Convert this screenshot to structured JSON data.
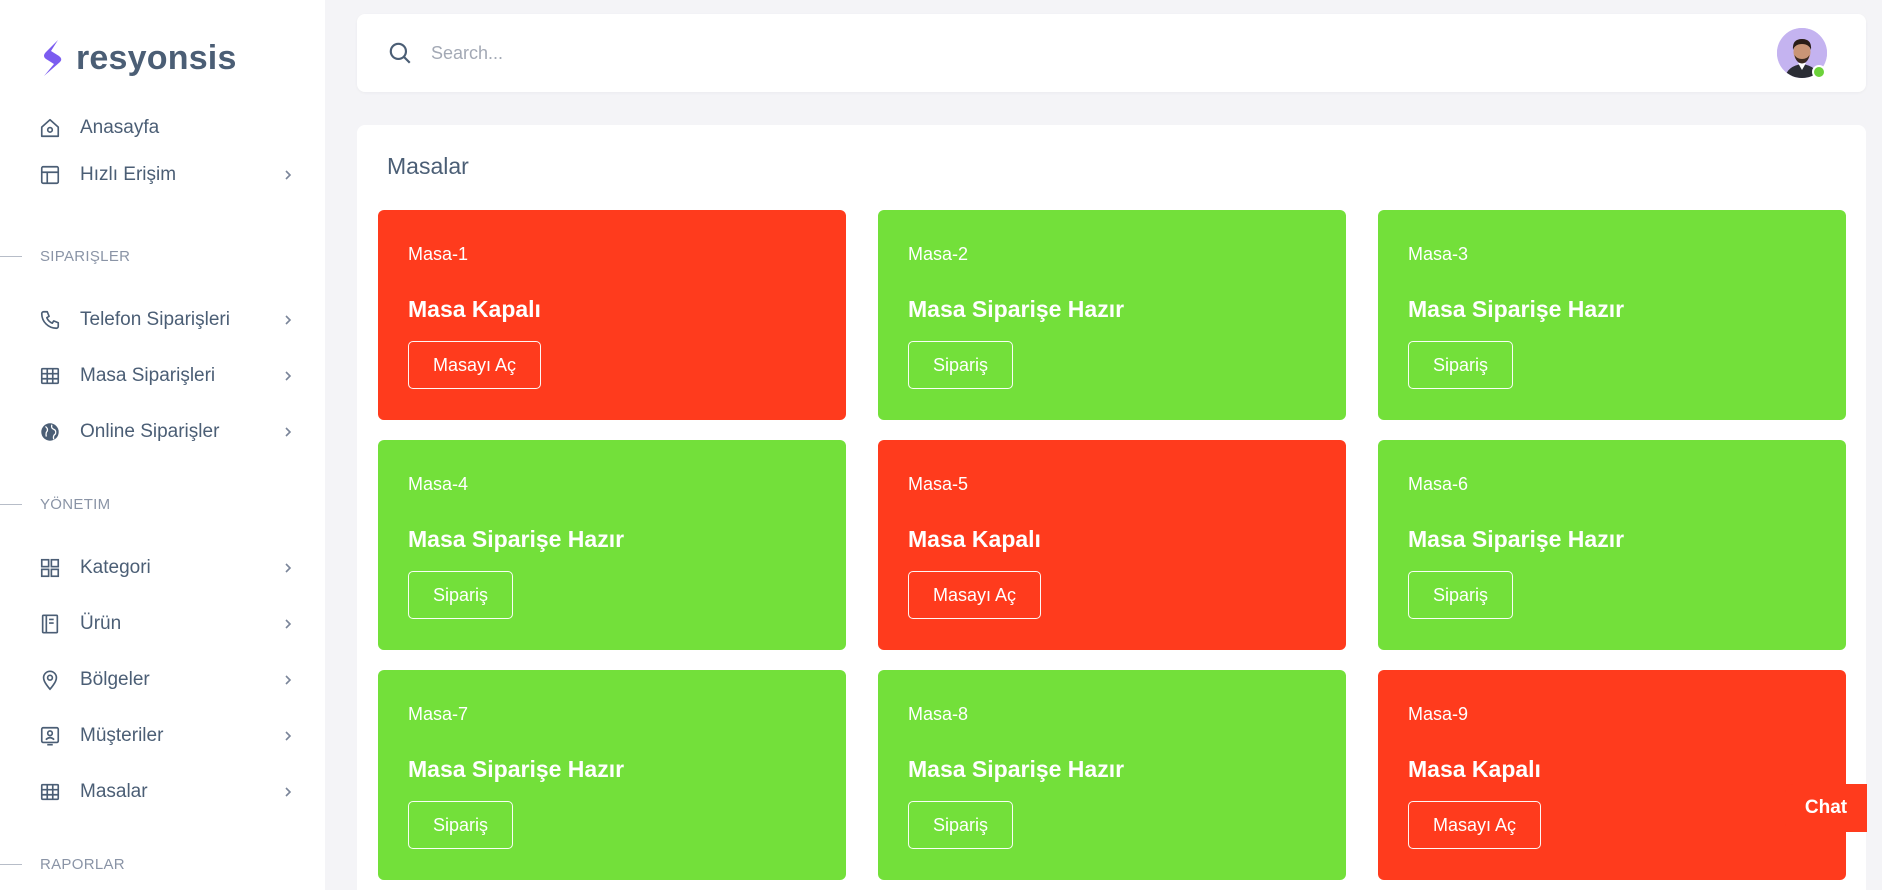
{
  "brand": {
    "name": "resyonsis"
  },
  "sidebar": {
    "items_top": [
      {
        "label": "Anasayfa",
        "icon": "home-icon",
        "chevron": false
      },
      {
        "label": "Hızlı Erişim",
        "icon": "layout-icon",
        "chevron": true
      }
    ],
    "section_orders": "SIPARIŞLER",
    "items_orders": [
      {
        "label": "Telefon Siparişleri",
        "icon": "phone-icon",
        "chevron": true
      },
      {
        "label": "Masa Siparişleri",
        "icon": "table-icon",
        "chevron": true
      },
      {
        "label": "Online Siparişler",
        "icon": "globe-icon",
        "chevron": true
      }
    ],
    "section_admin": "YÖNETIM",
    "items_admin": [
      {
        "label": "Kategori",
        "icon": "grid-icon",
        "chevron": true
      },
      {
        "label": "Ürün",
        "icon": "notebook-icon",
        "chevron": true
      },
      {
        "label": "Bölgeler",
        "icon": "map-pin-icon",
        "chevron": true
      },
      {
        "label": "Müşteriler",
        "icon": "contact-icon",
        "chevron": true
      },
      {
        "label": "Masalar",
        "icon": "table-icon",
        "chevron": true
      }
    ],
    "section_reports": "RAPORLAR"
  },
  "header": {
    "search_placeholder": "Search..."
  },
  "main": {
    "title": "Masalar",
    "tables": [
      {
        "name": "Masa-1",
        "status": "Masa Kapalı",
        "button": "Masayı Aç",
        "state": "closed"
      },
      {
        "name": "Masa-2",
        "status": "Masa Siparişe Hazır",
        "button": "Sipariş",
        "state": "ready"
      },
      {
        "name": "Masa-3",
        "status": "Masa Siparişe Hazır",
        "button": "Sipariş",
        "state": "ready"
      },
      {
        "name": "Masa-4",
        "status": "Masa Siparişe Hazır",
        "button": "Sipariş",
        "state": "ready"
      },
      {
        "name": "Masa-5",
        "status": "Masa Kapalı",
        "button": "Masayı Aç",
        "state": "closed"
      },
      {
        "name": "Masa-6",
        "status": "Masa Siparişe Hazır",
        "button": "Sipariş",
        "state": "ready"
      },
      {
        "name": "Masa-7",
        "status": "Masa Siparişe Hazır",
        "button": "Sipariş",
        "state": "ready"
      },
      {
        "name": "Masa-8",
        "status": "Masa Siparişe Hazır",
        "button": "Sipariş",
        "state": "ready"
      },
      {
        "name": "Masa-9",
        "status": "Masa Kapalı",
        "button": "Masayı Aç",
        "state": "closed"
      }
    ]
  },
  "chat": {
    "label": "Chat"
  },
  "colors": {
    "closed": "#ff3b1d",
    "ready": "#73e03a",
    "brand": "#7b5cf0",
    "text": "#4b5e75"
  }
}
